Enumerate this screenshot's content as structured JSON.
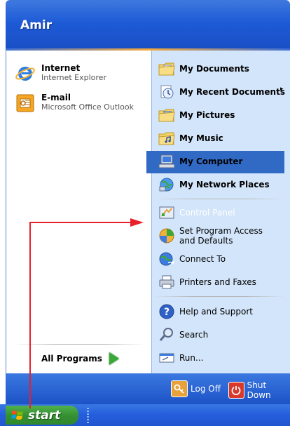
{
  "user": {
    "name": "Amir"
  },
  "pinned": [
    {
      "title": "Internet",
      "subtitle": "Internet Explorer",
      "icon": "internet-explorer-icon"
    },
    {
      "title": "E-mail",
      "subtitle": "Microsoft Office Outlook",
      "icon": "outlook-icon"
    }
  ],
  "all_programs_label": "All Programs",
  "places": [
    {
      "label": "My Documents",
      "icon": "folder-documents-icon"
    },
    {
      "label": "My Recent Documents",
      "icon": "recent-documents-icon",
      "submenu_glyph": "▸"
    },
    {
      "label": "My Pictures",
      "icon": "folder-pictures-icon"
    },
    {
      "label": "My Music",
      "icon": "folder-music-icon"
    },
    {
      "label": "My Computer",
      "icon": "computer-icon"
    },
    {
      "label": "My Network Places",
      "icon": "network-places-icon"
    }
  ],
  "system": [
    {
      "label": "Control Panel",
      "icon": "control-panel-icon",
      "highlighted": true
    },
    {
      "label": "Set Program Access and Defaults",
      "icon": "program-access-icon"
    },
    {
      "label": "Connect To",
      "icon": "connect-to-icon"
    },
    {
      "label": "Printers and Faxes",
      "icon": "printers-icon"
    }
  ],
  "help": [
    {
      "label": "Help and Support",
      "icon": "help-icon"
    },
    {
      "label": "Search",
      "icon": "search-icon"
    },
    {
      "label": "Run...",
      "icon": "run-icon"
    }
  ],
  "footer": {
    "logoff_label": "Log Off",
    "shutdown_label": "Shut Down"
  },
  "taskbar": {
    "start_label": "start"
  },
  "colors": {
    "highlight": "#316ac5",
    "annotation": "#e8202a",
    "header_blue": "#1d5ad6",
    "start_green": "#358f32"
  }
}
